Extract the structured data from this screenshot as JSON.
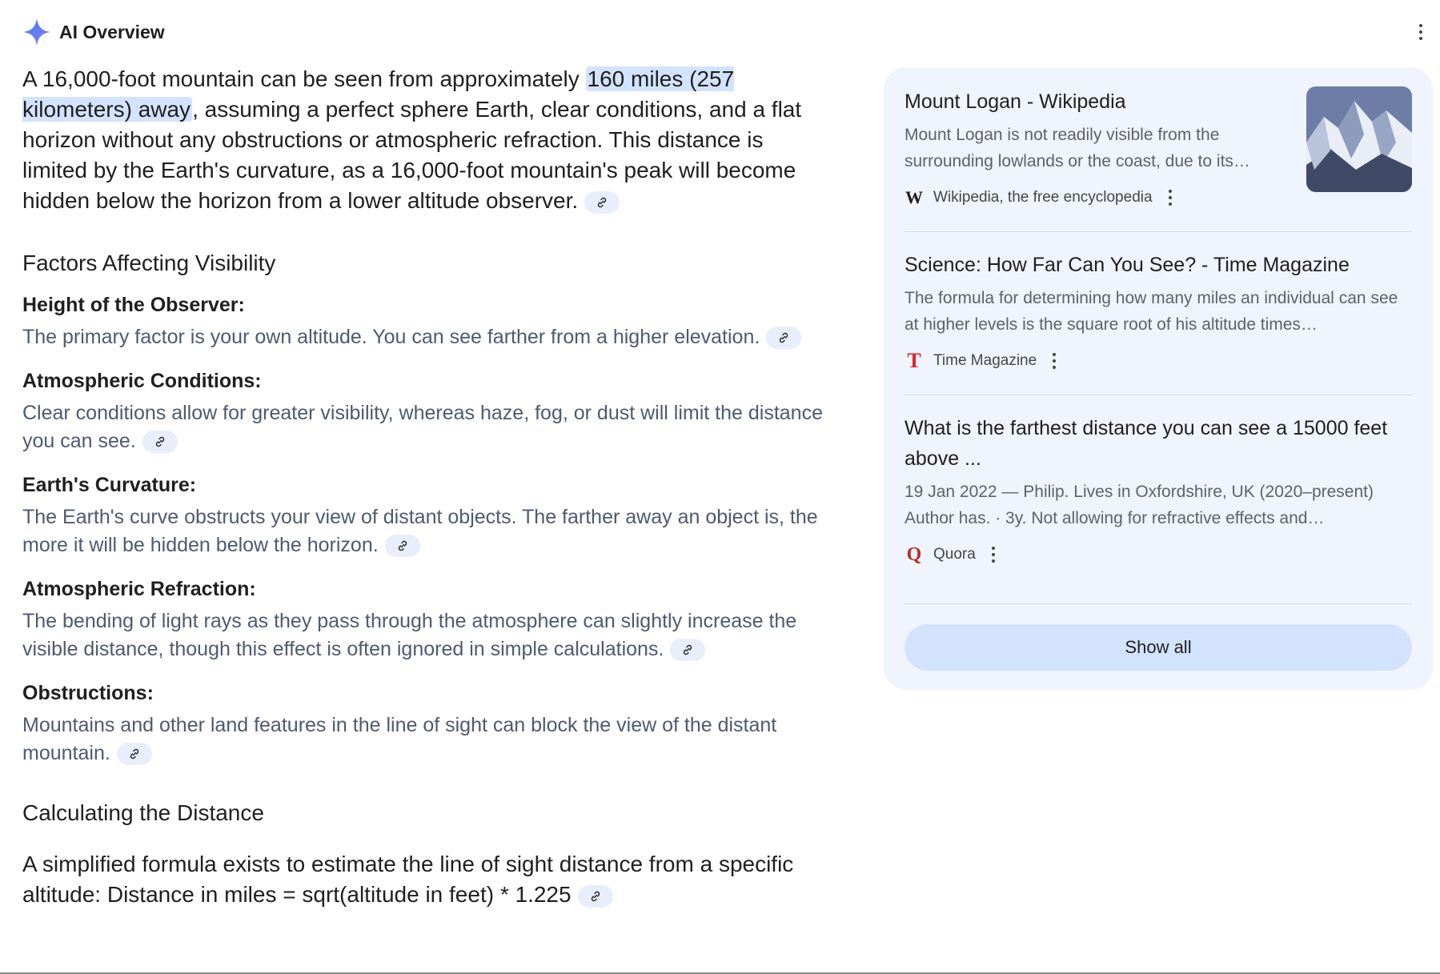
{
  "header": {
    "title": "AI Overview",
    "icon": "sparkle-icon"
  },
  "colors": {
    "accent": "#4f7cf7",
    "highlight": "#d3e3fd",
    "panel": "#f0f4fc",
    "citation": "#e8eefa"
  },
  "lead": {
    "before": "A 16,000-foot mountain can be seen from approximately ",
    "highlight": "160 miles (257 kilometers) away",
    "after": ", assuming a perfect sphere Earth, clear conditions, and a flat horizon without any obstructions or atmospheric refraction. This distance is limited by the Earth's curvature, as a 16,000-foot mountain's peak will become hidden below the horizon from a lower altitude observer."
  },
  "factors": {
    "heading": "Factors Affecting Visibility",
    "items": [
      {
        "title": "Height of the Observer:",
        "body": "The primary factor is your own altitude. You can see farther from a higher elevation."
      },
      {
        "title": "Atmospheric Conditions:",
        "body": "Clear conditions allow for greater visibility, whereas haze, fog, or dust will limit the distance you can see."
      },
      {
        "title": "Earth's Curvature:",
        "body": "The Earth's curve obstructs your view of distant objects. The farther away an object is, the more it will be hidden below the horizon."
      },
      {
        "title": "Atmospheric Refraction:",
        "body": "The bending of light rays as they pass through the atmosphere can slightly increase the visible distance, though this effect is often ignored in simple calculations."
      },
      {
        "title": "Obstructions:",
        "body": "Mountains and other land features in the line of sight can block the view of the distant mountain."
      }
    ]
  },
  "calculation": {
    "heading": "Calculating the Distance",
    "body": "A simplified formula exists to estimate the line of sight distance from a specific altitude: Distance in miles = sqrt(altitude in feet) * 1.225"
  },
  "sources": [
    {
      "title": "Mount Logan - Wikipedia",
      "snippet": "Mount Logan is not readily visible from the surrounding lowlands or the coast, due to its…",
      "site": "Wikipedia, the free encyclopedia",
      "favicon": "W"
    },
    {
      "title": "Science: How Far Can You See? - Time Magazine",
      "snippet": "The formula for determining how many miles an individual can see at higher levels is the square root of his altitude times…",
      "site": "Time Magazine",
      "favicon": "T"
    },
    {
      "title": "What is the farthest distance you can see a 15000 feet above ...",
      "snippet": "19 Jan 2022 — Philip. Lives in Oxfordshire, UK (2020–present) Author has. · 3y. Not allowing for refractive effects and…",
      "site": "Quora",
      "favicon": "Q"
    }
  ],
  "show_all_label": "Show all"
}
